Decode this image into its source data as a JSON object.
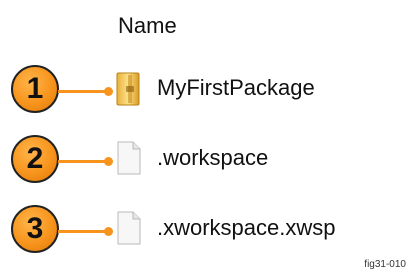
{
  "header": {
    "title": "Name"
  },
  "items": [
    {
      "number": "1",
      "name": "MyFirstPackage",
      "icon": "folder-icon"
    },
    {
      "number": "2",
      "name": ".workspace",
      "icon": "file-icon"
    },
    {
      "number": "3",
      "name": ".xworkspace.xwsp",
      "icon": "file-icon"
    }
  ],
  "figure_label": "fig31-010",
  "colors": {
    "callout": "#f7941d",
    "folder": "#f2c14e"
  }
}
